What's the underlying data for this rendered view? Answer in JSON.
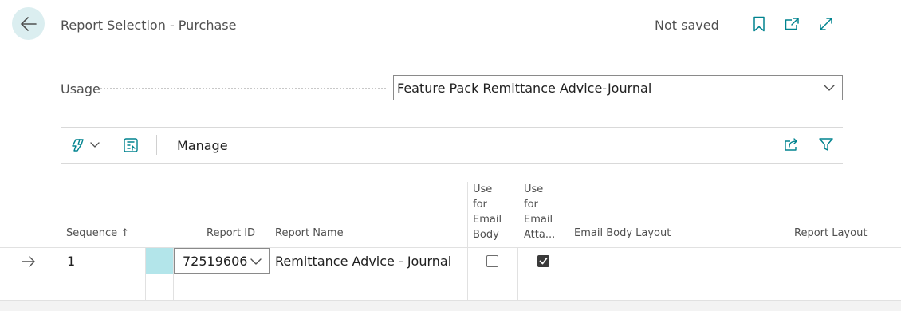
{
  "header": {
    "title": "Report Selection - Purchase",
    "status": "Not saved",
    "back_icon": "arrow-left",
    "icons": [
      "bookmark-icon",
      "open-in-new-window-icon",
      "expand-icon"
    ]
  },
  "usage": {
    "label": "Usage",
    "value": "Feature Pack Remittance Advice-Journal"
  },
  "toolbar": {
    "copilot_icon": "copilot-icon",
    "edit_list_icon": "edit-list-icon",
    "manage_label": "Manage",
    "share_icon": "share-icon",
    "filter_icon": "filter-icon"
  },
  "table": {
    "columns": {
      "sequence": "Sequence",
      "sort_indicator": "↑",
      "report_id": "Report ID",
      "report_name": "Report Name",
      "use_email_body": [
        "Use",
        "for",
        "Email",
        "Body"
      ],
      "use_email_attachment": [
        "Use",
        "for",
        "Email",
        "Atta..."
      ],
      "email_body_layout": "Email Body Layout",
      "report_layout": "Report Layout"
    },
    "rows": [
      {
        "sequence": "1",
        "report_id": "72519606",
        "report_name": "Remittance Advice - Journal",
        "use_email_body": false,
        "use_email_attachment": true,
        "email_body_layout": "",
        "report_layout": ""
      }
    ]
  },
  "colors": {
    "accent": "#00838f",
    "back_circle": "#dbeef0",
    "selected_cell": "#b3e5ea"
  }
}
